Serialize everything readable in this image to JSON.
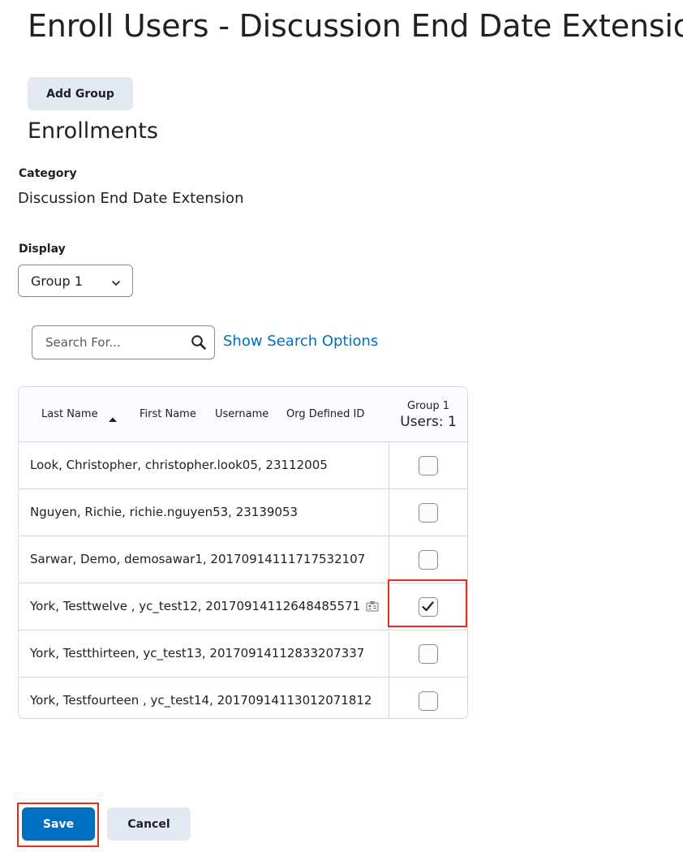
{
  "page": {
    "title": "Enroll Users - Discussion End Date Extension"
  },
  "actions": {
    "add_group_label": "Add Group",
    "save_label": "Save",
    "cancel_label": "Cancel"
  },
  "enrollments": {
    "heading": "Enrollments",
    "category_label": "Category",
    "category_value": "Discussion End Date Extension",
    "display_label": "Display",
    "display_selected": "Group 1"
  },
  "search": {
    "placeholder": "Search For...",
    "options_link": "Show Search Options"
  },
  "table": {
    "columns": {
      "last_name": "Last Name",
      "first_name": "First Name",
      "username": "Username",
      "org_id": "Org Defined ID",
      "group_name": "Group 1",
      "group_count": "Users: 1"
    },
    "rows": [
      {
        "text": "Look, Christopher, christopher.look05, 23112005",
        "checked": false
      },
      {
        "text": "Nguyen, Richie, richie.nguyen53, 23139053",
        "checked": false
      },
      {
        "text": "Sarwar, Demo, demosawar1, 20170914111717532107",
        "checked": false
      },
      {
        "text": "York, Testtwelve , yc_test12, 20170914112648485571",
        "checked": true,
        "icon": "user-card-icon"
      },
      {
        "text": "York, Testthirteen, yc_test13, 20170914112833207337",
        "checked": false
      },
      {
        "text": "York, Testfourteen , yc_test14, 20170914113012071812",
        "checked": false
      }
    ]
  },
  "colors": {
    "primary": "#006fbf",
    "secondary_bg": "#e3e9f1",
    "highlight": "#e32e1a",
    "border": "#d3d9e3"
  },
  "icons": {
    "search": "magnifier-icon",
    "sort": "sort-ascending-icon",
    "dropdown": "chevron-down-icon",
    "check": "checkmark-icon"
  }
}
